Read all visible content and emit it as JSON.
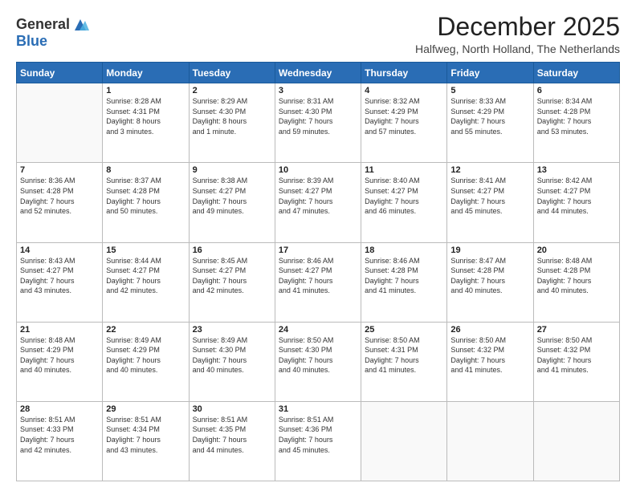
{
  "logo": {
    "general": "General",
    "blue": "Blue"
  },
  "header": {
    "month": "December 2025",
    "location": "Halfweg, North Holland, The Netherlands"
  },
  "weekdays": [
    "Sunday",
    "Monday",
    "Tuesday",
    "Wednesday",
    "Thursday",
    "Friday",
    "Saturday"
  ],
  "weeks": [
    [
      {
        "day": "",
        "detail": ""
      },
      {
        "day": "1",
        "detail": "Sunrise: 8:28 AM\nSunset: 4:31 PM\nDaylight: 8 hours\nand 3 minutes."
      },
      {
        "day": "2",
        "detail": "Sunrise: 8:29 AM\nSunset: 4:30 PM\nDaylight: 8 hours\nand 1 minute."
      },
      {
        "day": "3",
        "detail": "Sunrise: 8:31 AM\nSunset: 4:30 PM\nDaylight: 7 hours\nand 59 minutes."
      },
      {
        "day": "4",
        "detail": "Sunrise: 8:32 AM\nSunset: 4:29 PM\nDaylight: 7 hours\nand 57 minutes."
      },
      {
        "day": "5",
        "detail": "Sunrise: 8:33 AM\nSunset: 4:29 PM\nDaylight: 7 hours\nand 55 minutes."
      },
      {
        "day": "6",
        "detail": "Sunrise: 8:34 AM\nSunset: 4:28 PM\nDaylight: 7 hours\nand 53 minutes."
      }
    ],
    [
      {
        "day": "7",
        "detail": "Sunrise: 8:36 AM\nSunset: 4:28 PM\nDaylight: 7 hours\nand 52 minutes."
      },
      {
        "day": "8",
        "detail": "Sunrise: 8:37 AM\nSunset: 4:28 PM\nDaylight: 7 hours\nand 50 minutes."
      },
      {
        "day": "9",
        "detail": "Sunrise: 8:38 AM\nSunset: 4:27 PM\nDaylight: 7 hours\nand 49 minutes."
      },
      {
        "day": "10",
        "detail": "Sunrise: 8:39 AM\nSunset: 4:27 PM\nDaylight: 7 hours\nand 47 minutes."
      },
      {
        "day": "11",
        "detail": "Sunrise: 8:40 AM\nSunset: 4:27 PM\nDaylight: 7 hours\nand 46 minutes."
      },
      {
        "day": "12",
        "detail": "Sunrise: 8:41 AM\nSunset: 4:27 PM\nDaylight: 7 hours\nand 45 minutes."
      },
      {
        "day": "13",
        "detail": "Sunrise: 8:42 AM\nSunset: 4:27 PM\nDaylight: 7 hours\nand 44 minutes."
      }
    ],
    [
      {
        "day": "14",
        "detail": "Sunrise: 8:43 AM\nSunset: 4:27 PM\nDaylight: 7 hours\nand 43 minutes."
      },
      {
        "day": "15",
        "detail": "Sunrise: 8:44 AM\nSunset: 4:27 PM\nDaylight: 7 hours\nand 42 minutes."
      },
      {
        "day": "16",
        "detail": "Sunrise: 8:45 AM\nSunset: 4:27 PM\nDaylight: 7 hours\nand 42 minutes."
      },
      {
        "day": "17",
        "detail": "Sunrise: 8:46 AM\nSunset: 4:27 PM\nDaylight: 7 hours\nand 41 minutes."
      },
      {
        "day": "18",
        "detail": "Sunrise: 8:46 AM\nSunset: 4:28 PM\nDaylight: 7 hours\nand 41 minutes."
      },
      {
        "day": "19",
        "detail": "Sunrise: 8:47 AM\nSunset: 4:28 PM\nDaylight: 7 hours\nand 40 minutes."
      },
      {
        "day": "20",
        "detail": "Sunrise: 8:48 AM\nSunset: 4:28 PM\nDaylight: 7 hours\nand 40 minutes."
      }
    ],
    [
      {
        "day": "21",
        "detail": "Sunrise: 8:48 AM\nSunset: 4:29 PM\nDaylight: 7 hours\nand 40 minutes."
      },
      {
        "day": "22",
        "detail": "Sunrise: 8:49 AM\nSunset: 4:29 PM\nDaylight: 7 hours\nand 40 minutes."
      },
      {
        "day": "23",
        "detail": "Sunrise: 8:49 AM\nSunset: 4:30 PM\nDaylight: 7 hours\nand 40 minutes."
      },
      {
        "day": "24",
        "detail": "Sunrise: 8:50 AM\nSunset: 4:30 PM\nDaylight: 7 hours\nand 40 minutes."
      },
      {
        "day": "25",
        "detail": "Sunrise: 8:50 AM\nSunset: 4:31 PM\nDaylight: 7 hours\nand 41 minutes."
      },
      {
        "day": "26",
        "detail": "Sunrise: 8:50 AM\nSunset: 4:32 PM\nDaylight: 7 hours\nand 41 minutes."
      },
      {
        "day": "27",
        "detail": "Sunrise: 8:50 AM\nSunset: 4:32 PM\nDaylight: 7 hours\nand 41 minutes."
      }
    ],
    [
      {
        "day": "28",
        "detail": "Sunrise: 8:51 AM\nSunset: 4:33 PM\nDaylight: 7 hours\nand 42 minutes."
      },
      {
        "day": "29",
        "detail": "Sunrise: 8:51 AM\nSunset: 4:34 PM\nDaylight: 7 hours\nand 43 minutes."
      },
      {
        "day": "30",
        "detail": "Sunrise: 8:51 AM\nSunset: 4:35 PM\nDaylight: 7 hours\nand 44 minutes."
      },
      {
        "day": "31",
        "detail": "Sunrise: 8:51 AM\nSunset: 4:36 PM\nDaylight: 7 hours\nand 45 minutes."
      },
      {
        "day": "",
        "detail": ""
      },
      {
        "day": "",
        "detail": ""
      },
      {
        "day": "",
        "detail": ""
      }
    ]
  ]
}
